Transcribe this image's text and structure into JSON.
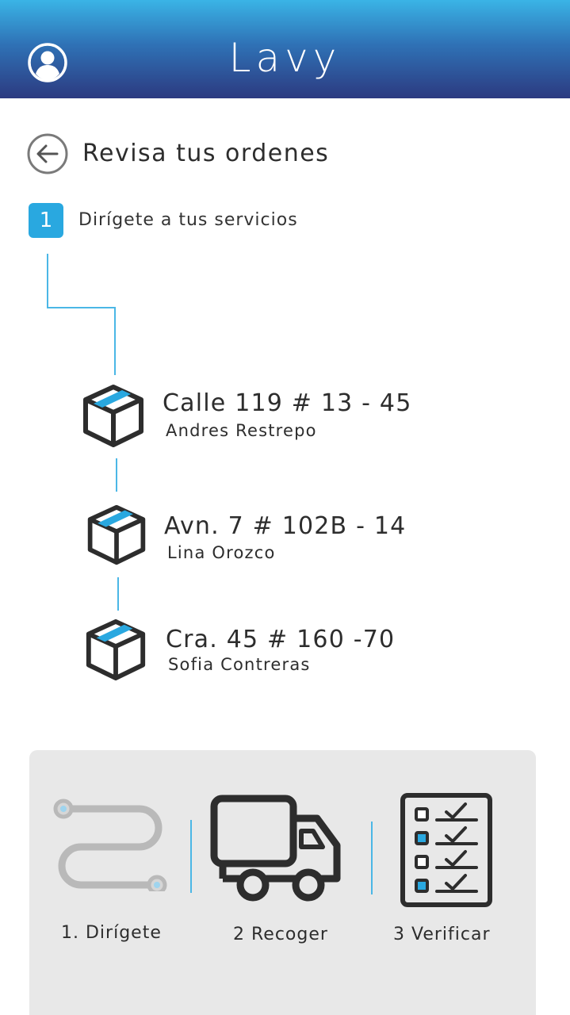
{
  "header": {
    "brand": "Lavy",
    "profile_icon": "user-circle-icon"
  },
  "title_row": {
    "back_icon": "arrow-left-circle-icon",
    "title": "Revisa tus ordenes"
  },
  "step": {
    "number": "1",
    "label": "Dirígete a tus servicios"
  },
  "orders": [
    {
      "address": "Calle 119 # 13 - 45",
      "name": "Andres Restrepo",
      "icon": "package-box-icon"
    },
    {
      "address": "Avn. 7 # 102B - 14",
      "name": "Lina Orozco",
      "icon": "package-box-icon"
    },
    {
      "address": "Cra. 45 # 160  -70",
      "name": "Sofia Contreras",
      "icon": "package-box-icon"
    }
  ],
  "bottom_nav": [
    {
      "label": "1. Dirígete",
      "icon": "route-path-icon"
    },
    {
      "label": "2 Recoger",
      "icon": "truck-icon"
    },
    {
      "label": "3 Verificar",
      "icon": "checklist-icon"
    }
  ],
  "colors": {
    "header_top": "#3ab4e6",
    "header_bottom": "#2c3a80",
    "accent": "#29a8e0",
    "text": "#2d2d2d",
    "panel": "#e8e8e8"
  }
}
